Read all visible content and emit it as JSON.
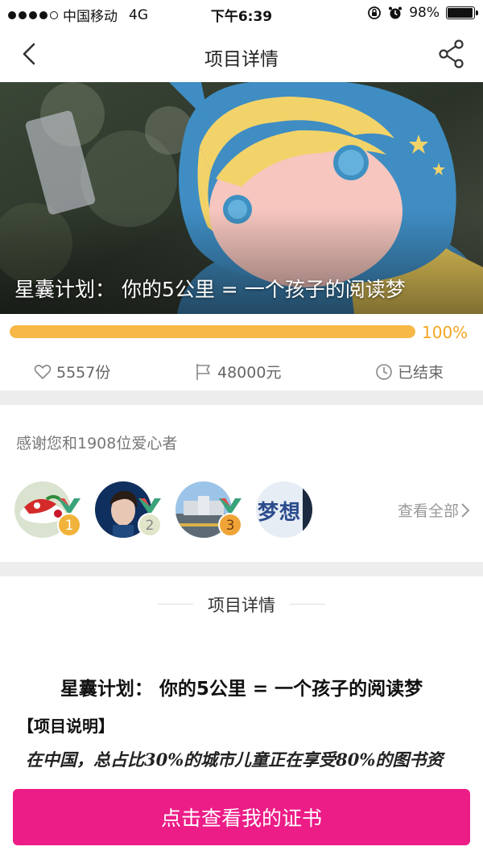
{
  "status_bar": {
    "carrier": "中国移动",
    "network": "4G",
    "time": "下午6:39",
    "battery": "98%",
    "battery_level": 0.98
  },
  "nav": {
    "title": "项目详情",
    "back_icon": "back-icon",
    "share_icon": "share-icon"
  },
  "hero": {
    "title": "星囊计划： 你的5公里 = 一个孩子的阅读梦"
  },
  "progress": {
    "value": 1.0,
    "label": "100%",
    "color": "#f7b847"
  },
  "stats": {
    "likes": "5557份",
    "amount": "48000元",
    "status": "已结束"
  },
  "donors": {
    "title": "感谢您和1908位爱心者",
    "ranks": [
      "1",
      "2",
      "3"
    ],
    "view_all": "查看全部",
    "avatar4_text": "梦想"
  },
  "detail": {
    "heading": "项目详情",
    "content_title": "星囊计划： 你的5公里 = 一个孩子的阅读梦",
    "section_label": "【项目说明】",
    "paragraph": "在中国，总占比30%的城市儿童正在享受80%的图书资"
  },
  "cta": {
    "label": "点击查看我的证书",
    "color": "#ec1d87"
  }
}
